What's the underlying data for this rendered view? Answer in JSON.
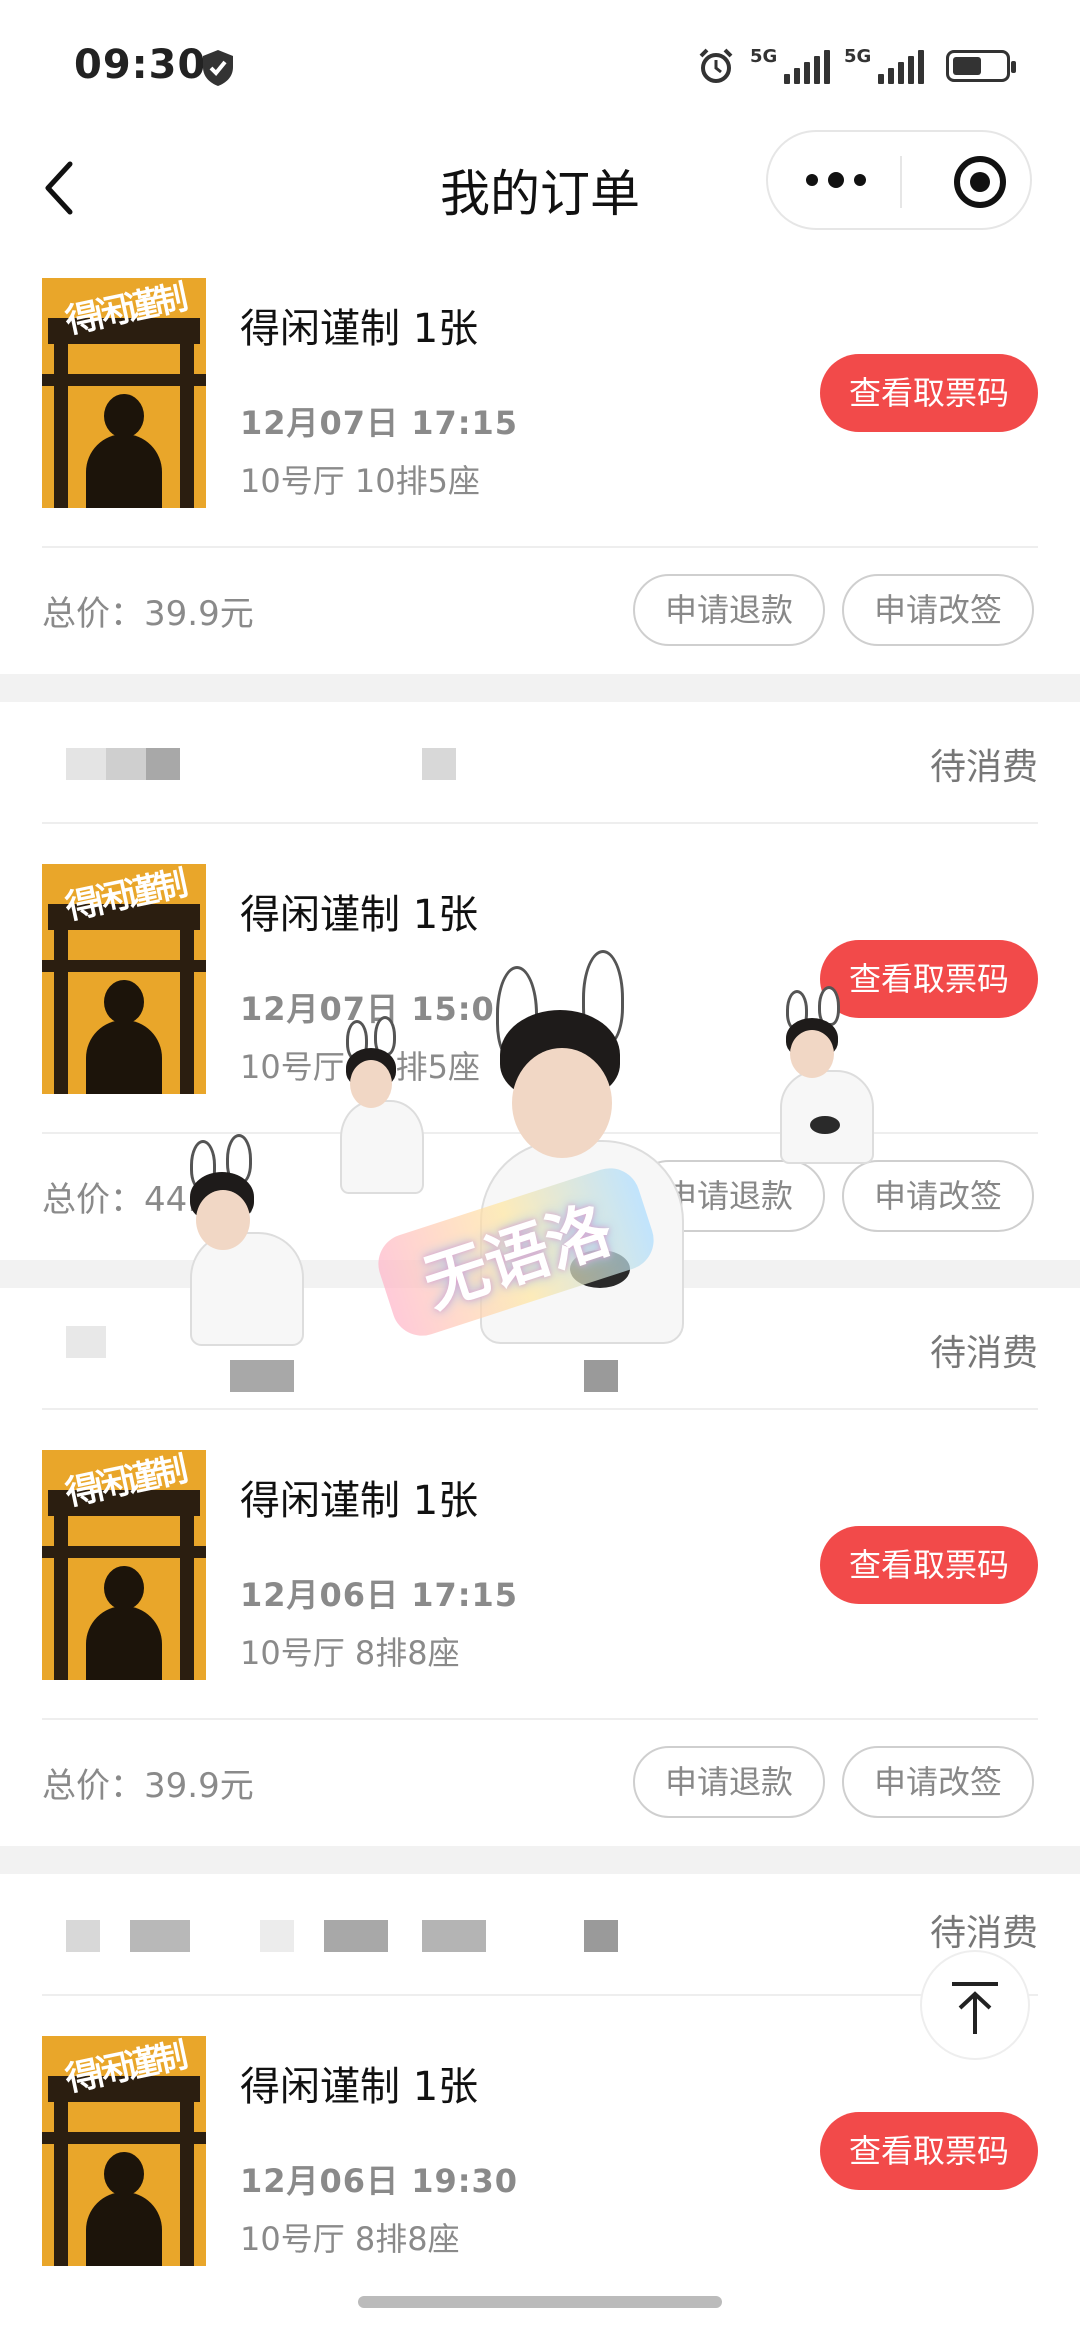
{
  "status_bar": {
    "time": "09:30",
    "network_1": "5G",
    "network_2": "5G"
  },
  "nav": {
    "title": "我的订单"
  },
  "orders": [
    {
      "status": "",
      "movie": "得闲谨制 1张",
      "datetime": "12月07日 17:15",
      "seat": "10号厅 10排5座",
      "ticket_btn": "查看取票码",
      "total": "总价：39.9元",
      "refund": "申请退款",
      "change": "申请改签"
    },
    {
      "status": "待消费",
      "movie": "得闲谨制 1张",
      "datetime": "12月07日 15:00",
      "seat": "10号厅 10排5座",
      "ticket_btn": "查看取票码",
      "total": "总价：44.9元",
      "refund": "申请退款",
      "change": "申请改签"
    },
    {
      "status": "待消费",
      "movie": "得闲谨制 1张",
      "datetime": "12月06日 17:15",
      "seat": "10号厅 8排8座",
      "ticket_btn": "查看取票码",
      "total": "总价：39.9元",
      "refund": "申请退款",
      "change": "申请改签"
    },
    {
      "status": "待消费",
      "movie": "得闲谨制 1张",
      "datetime": "12月06日 19:30",
      "seat": "10号厅 8排8座",
      "ticket_btn": "查看取票码"
    }
  ],
  "poster": {
    "title": "得闲谨制"
  },
  "sticker": {
    "text": "无语洛"
  },
  "colors": {
    "accent": "#f24a4a",
    "poster": "#e9a62a"
  }
}
